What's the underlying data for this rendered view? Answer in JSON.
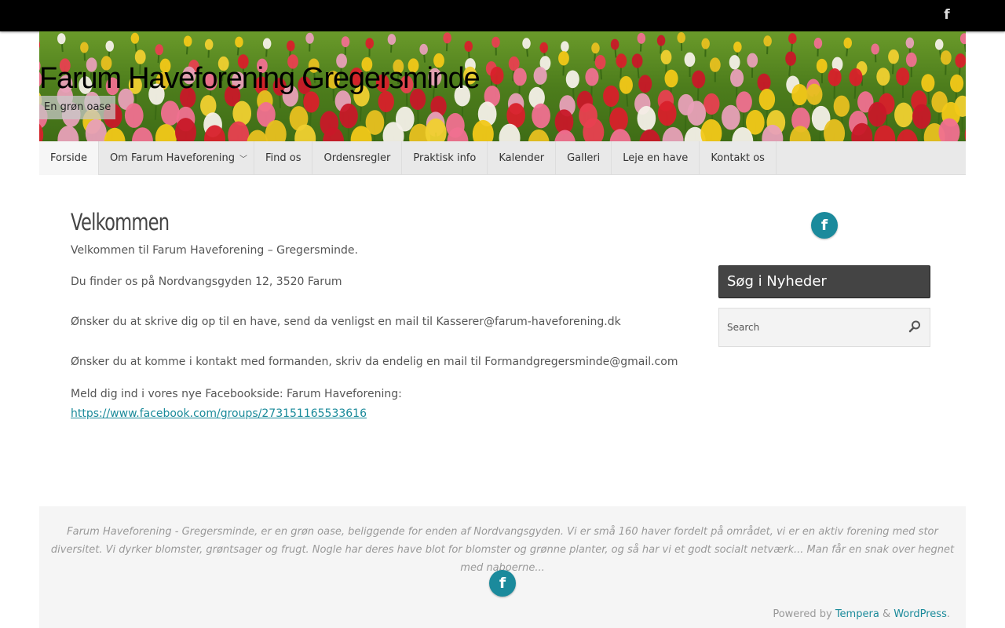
{
  "topbar": {
    "social_icon": "facebook-icon",
    "social_glyph": "f"
  },
  "header": {
    "site_title": "Farum Haveforening Gregersminde",
    "tagline": "En grøn oase"
  },
  "nav": {
    "items": [
      {
        "label": "Forside"
      },
      {
        "label": "Om Farum Haveforening",
        "chevron": "﹀"
      },
      {
        "label": "Find os"
      },
      {
        "label": "Ordensregler"
      },
      {
        "label": "Praktisk info"
      },
      {
        "label": "Kalender"
      },
      {
        "label": "Galleri"
      },
      {
        "label": "Leje en have"
      },
      {
        "label": "Kontakt os"
      }
    ]
  },
  "content": {
    "title": "Velkommen",
    "p1": "Velkommen til Farum Haveforening – Gregersminde.",
    "p2": "Du finder os på Nordvangsgyden 12, 3520 Farum",
    "p3": "Ønsker du at skrive dig op til en have, send da venligst en mail til Kasserer@farum-haveforening.dk",
    "p4": "Ønsker du at komme i kontakt med formanden, skriv da endelig en mail til Formandgregersminde@gmail.com",
    "p5": "Meld dig ind i vores nye Facebookside: Farum Haveforening:",
    "fb_link": "https://www.facebook.com/groups/273151165533616"
  },
  "sidebar": {
    "social_glyph": "f",
    "widget_title": "Søg i Nyheder",
    "search_placeholder": "Search"
  },
  "footer": {
    "text": "Farum Haveforening - Gregersminde, er en grøn oase, beliggende for enden af Nordvangsgyden. Vi er små 160 haver fordelt på området, vi er en aktiv forening med stor diversitet. Vi dyrker blomster, grøntsager og frugt. Nogle har deres have blot for blomster og grønne planter, og så har vi et godt socialt netværk... Man får en snak over hegnet med naboerne...",
    "social_glyph": "f",
    "powered_by": "Powered by",
    "theme_link": "Tempera",
    "amp": "&",
    "wp_link": "WordPress",
    "period": "."
  },
  "colors": {
    "accent": "#1b8a9c",
    "topbar": "#000000",
    "widget_title_bg": "#444444",
    "nav_bg": "#e9e9e9",
    "footer_bg": "#f5f5f5"
  }
}
